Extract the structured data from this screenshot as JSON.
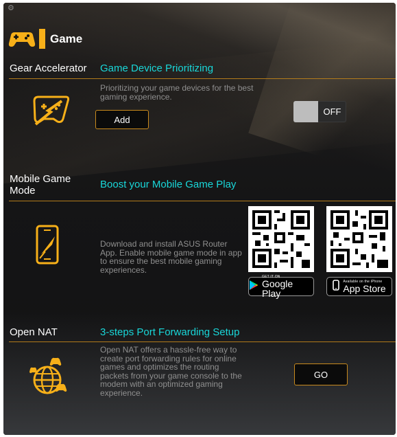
{
  "header": {
    "title": "Game",
    "icon": "gamepad-icon"
  },
  "colors": {
    "accent": "#f7b019",
    "link": "#19d7d9",
    "divider": "#b47c1b",
    "text_muted": "#8f8f8f"
  },
  "gear_accelerator": {
    "left_title": "Gear Accelerator",
    "right_title": "Game Device Prioritizing",
    "description": "Prioritizing your game devices for the best gaming experience.",
    "add_label": "Add",
    "toggle_state": "OFF",
    "icon": "gamepad-lightning-icon"
  },
  "mobile_game": {
    "left_title": "Mobile Game Mode",
    "right_title": "Boost your Mobile Game Play",
    "description": "Download and install ASUS Router App. Enable mobile game mode in app to ensure the best mobile gaming experiences.",
    "google_play": {
      "small": "GET IT ON",
      "big": "Google Play"
    },
    "app_store": {
      "small": "Available on the iPhone",
      "big": "App Store"
    },
    "icon": "phone-rocket-icon"
  },
  "open_nat": {
    "left_title": "Open NAT",
    "right_title": "3-steps Port Forwarding Setup",
    "description": "Open NAT offers a hassle-free way to create port forwarding rules for online games and optimizes the routing packets from your game console to the modem with an optimized gaming experience.",
    "go_label": "GO",
    "icon": "globe-gamepad-icon"
  }
}
